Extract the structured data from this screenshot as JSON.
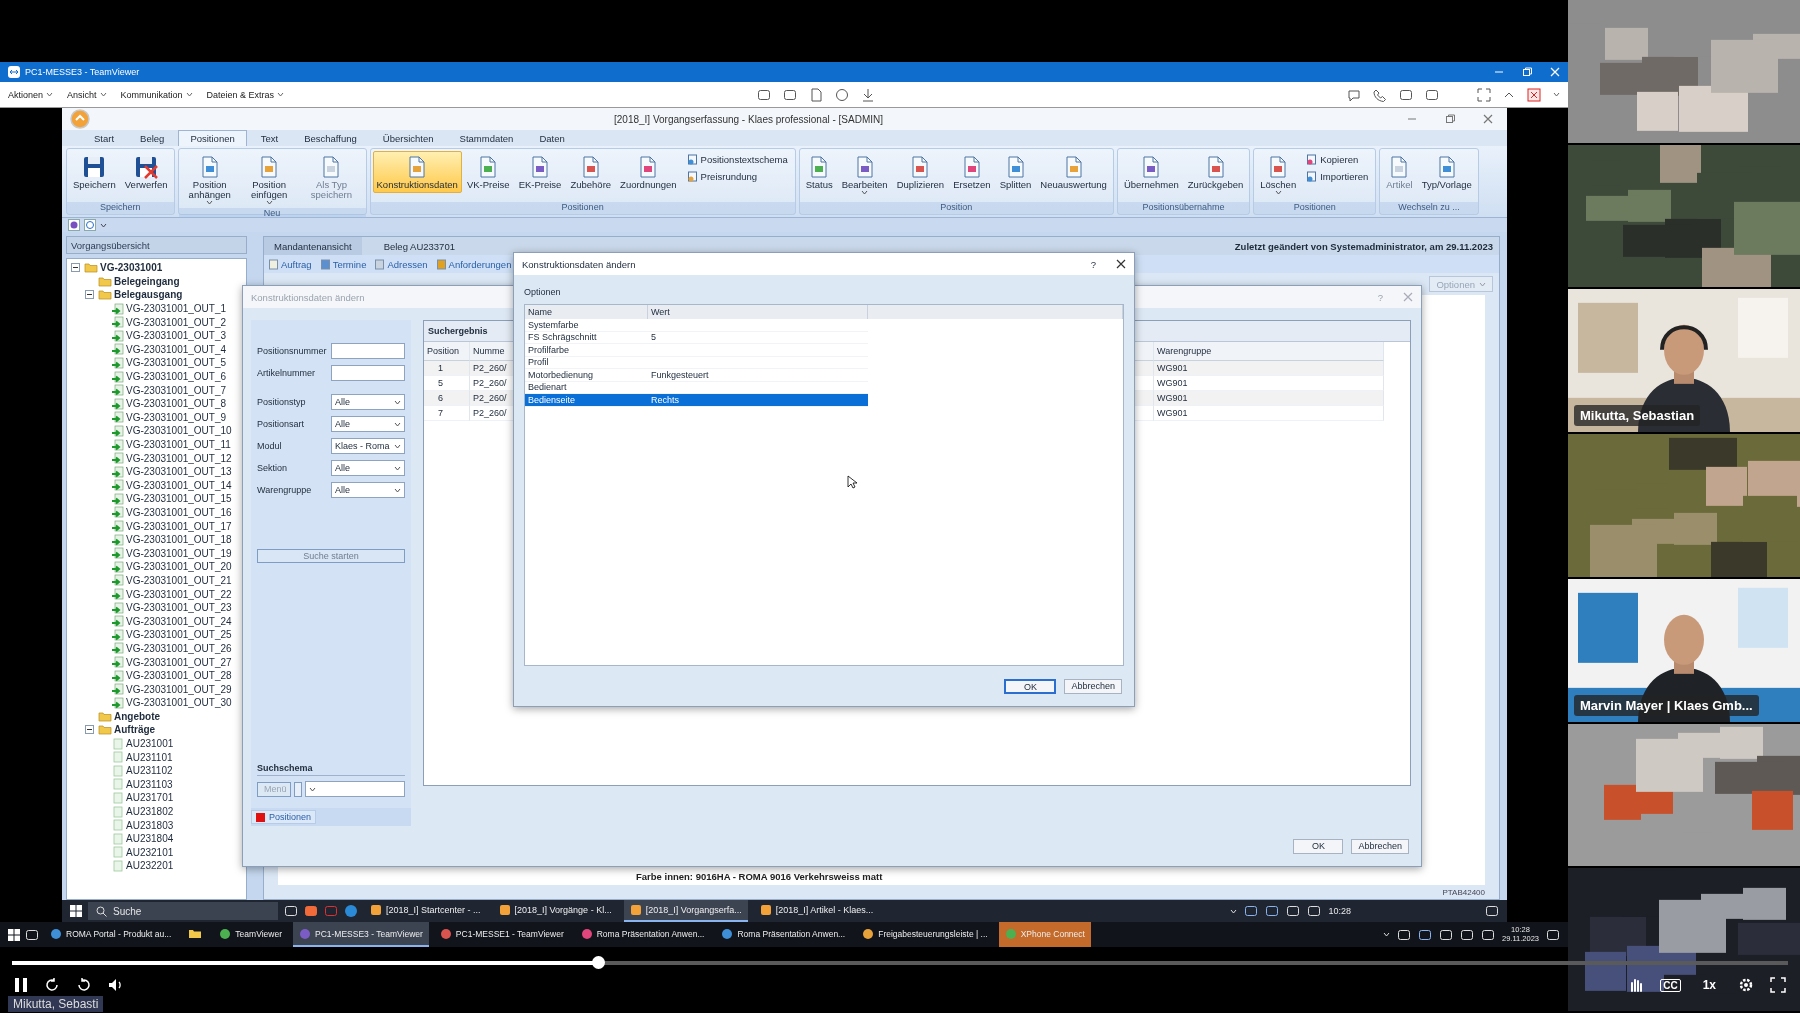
{
  "teamviewer": {
    "title": "PC1-MESSE3 - TeamViewer",
    "menu": [
      "Aktionen",
      "Ansicht",
      "Kommunikation",
      "Dateien & Extras"
    ]
  },
  "app": {
    "title": "[2018_I] Vorgangserfassung - Klaes professional - [SADMIN]",
    "ribbon_tabs": [
      {
        "label": "Start",
        "selected": false
      },
      {
        "label": "Beleg",
        "selected": false
      },
      {
        "label": "Positionen",
        "selected": true
      },
      {
        "label": "Text",
        "selected": false
      },
      {
        "label": "Beschaffung",
        "selected": false
      },
      {
        "label": "Übersichten",
        "selected": false
      },
      {
        "label": "Stammdaten",
        "selected": false
      },
      {
        "label": "Daten",
        "selected": false
      }
    ],
    "ribbon_groups": [
      {
        "label": "Speichern",
        "buttons": [
          {
            "label": "Speichern",
            "kind": "large",
            "disabled": false,
            "selected": false,
            "dropdown": false
          },
          {
            "label": "Verwerfen",
            "kind": "large",
            "disabled": false,
            "selected": false,
            "dropdown": false
          }
        ]
      },
      {
        "label": "Neu",
        "buttons": [
          {
            "label": "Position anhängen",
            "kind": "large",
            "disabled": false,
            "selected": false,
            "dropdown": true
          },
          {
            "label": "Position einfügen",
            "kind": "large",
            "disabled": false,
            "selected": false,
            "dropdown": true
          },
          {
            "label": "Als Typ speichern",
            "kind": "large",
            "disabled": true,
            "selected": false,
            "dropdown": false
          }
        ]
      },
      {
        "label": "Positionen",
        "buttons": [
          {
            "label": "Konstruktionsdaten",
            "kind": "large",
            "disabled": false,
            "selected": true,
            "dropdown": false
          },
          {
            "label": "VK-Preise",
            "kind": "large",
            "disabled": false,
            "selected": false,
            "dropdown": false
          },
          {
            "label": "EK-Preise",
            "kind": "large",
            "disabled": false,
            "selected": false,
            "dropdown": false
          },
          {
            "label": "Zubehöre",
            "kind": "large",
            "disabled": false,
            "selected": false,
            "dropdown": false
          },
          {
            "label": "Zuordnungen",
            "kind": "large",
            "disabled": false,
            "selected": false,
            "dropdown": false
          },
          {
            "label": "Positionstextschema",
            "kind": "small",
            "disabled": false,
            "selected": false,
            "dropdown": false
          },
          {
            "label": "Preisrundung",
            "kind": "small",
            "disabled": false,
            "selected": false,
            "dropdown": false
          }
        ]
      },
      {
        "label": "Position",
        "buttons": [
          {
            "label": "Status",
            "kind": "large",
            "disabled": false,
            "selected": false,
            "dropdown": false
          },
          {
            "label": "Bearbeiten",
            "kind": "large",
            "disabled": false,
            "selected": false,
            "dropdown": true
          },
          {
            "label": "Duplizieren",
            "kind": "large",
            "disabled": false,
            "selected": false,
            "dropdown": false
          },
          {
            "label": "Ersetzen",
            "kind": "large",
            "disabled": false,
            "selected": false,
            "dropdown": false
          },
          {
            "label": "Splitten",
            "kind": "large",
            "disabled": false,
            "selected": false,
            "dropdown": false
          },
          {
            "label": "Neuauswertung",
            "kind": "large",
            "disabled": false,
            "selected": false,
            "dropdown": false
          }
        ]
      },
      {
        "label": "Positionsübernahme",
        "buttons": [
          {
            "label": "Übernehmen",
            "kind": "large",
            "disabled": false,
            "selected": false,
            "dropdown": false
          },
          {
            "label": "Zurückgeben",
            "kind": "large",
            "disabled": false,
            "selected": false,
            "dropdown": false
          }
        ]
      },
      {
        "label": "Positionen",
        "buttons": [
          {
            "label": "Löschen",
            "kind": "large",
            "disabled": false,
            "selected": false,
            "dropdown": true
          },
          {
            "label": "Kopieren",
            "kind": "small",
            "disabled": false,
            "selected": false,
            "dropdown": false
          },
          {
            "label": "Importieren",
            "kind": "small",
            "disabled": false,
            "selected": false,
            "dropdown": false
          }
        ]
      },
      {
        "label": "Wechseln zu ...",
        "buttons": [
          {
            "label": "Artikel",
            "kind": "large",
            "disabled": true,
            "selected": false,
            "dropdown": false
          },
          {
            "label": "Typ/Vorlage",
            "kind": "large",
            "disabled": false,
            "selected": false,
            "dropdown": false
          }
        ]
      }
    ]
  },
  "overview": {
    "title": "Vorgangsübersicht",
    "tree": [
      {
        "label": "VG-23031001",
        "kind": "folder",
        "expanded": true,
        "children": [
          {
            "label": "Belegeingang",
            "kind": "folder"
          },
          {
            "label": "Belegausgang",
            "kind": "folder",
            "expanded": true,
            "children": [
              {
                "label": "VG-23031001_OUT_1",
                "kind": "outgoing"
              },
              {
                "label": "VG-23031001_OUT_2",
                "kind": "outgoing"
              },
              {
                "label": "VG-23031001_OUT_3",
                "kind": "outgoing"
              },
              {
                "label": "VG-23031001_OUT_4",
                "kind": "outgoing"
              },
              {
                "label": "VG-23031001_OUT_5",
                "kind": "outgoing"
              },
              {
                "label": "VG-23031001_OUT_6",
                "kind": "outgoing"
              },
              {
                "label": "VG-23031001_OUT_7",
                "kind": "outgoing"
              },
              {
                "label": "VG-23031001_OUT_8",
                "kind": "outgoing"
              },
              {
                "label": "VG-23031001_OUT_9",
                "kind": "outgoing"
              },
              {
                "label": "VG-23031001_OUT_10",
                "kind": "outgoing"
              },
              {
                "label": "VG-23031001_OUT_11",
                "kind": "outgoing"
              },
              {
                "label": "VG-23031001_OUT_12",
                "kind": "outgoing"
              },
              {
                "label": "VG-23031001_OUT_13",
                "kind": "outgoing"
              },
              {
                "label": "VG-23031001_OUT_14",
                "kind": "outgoing"
              },
              {
                "label": "VG-23031001_OUT_15",
                "kind": "outgoing"
              },
              {
                "label": "VG-23031001_OUT_16",
                "kind": "outgoing"
              },
              {
                "label": "VG-23031001_OUT_17",
                "kind": "outgoing"
              },
              {
                "label": "VG-23031001_OUT_18",
                "kind": "outgoing"
              },
              {
                "label": "VG-23031001_OUT_19",
                "kind": "outgoing"
              },
              {
                "label": "VG-23031001_OUT_20",
                "kind": "outgoing"
              },
              {
                "label": "VG-23031001_OUT_21",
                "kind": "outgoing"
              },
              {
                "label": "VG-23031001_OUT_22",
                "kind": "outgoing"
              },
              {
                "label": "VG-23031001_OUT_23",
                "kind": "outgoing"
              },
              {
                "label": "VG-23031001_OUT_24",
                "kind": "outgoing"
              },
              {
                "label": "VG-23031001_OUT_25",
                "kind": "outgoing"
              },
              {
                "label": "VG-23031001_OUT_26",
                "kind": "outgoing"
              },
              {
                "label": "VG-23031001_OUT_27",
                "kind": "outgoing"
              },
              {
                "label": "VG-23031001_OUT_28",
                "kind": "outgoing"
              },
              {
                "label": "VG-23031001_OUT_29",
                "kind": "outgoing"
              },
              {
                "label": "VG-23031001_OUT_30",
                "kind": "outgoing"
              }
            ]
          },
          {
            "label": "Angebote",
            "kind": "folder"
          },
          {
            "label": "Aufträge",
            "kind": "folder",
            "expanded": true,
            "children": [
              {
                "label": "AU231001",
                "kind": "order"
              },
              {
                "label": "AU231101",
                "kind": "order"
              },
              {
                "label": "AU231102",
                "kind": "order"
              },
              {
                "label": "AU231103",
                "kind": "order"
              },
              {
                "label": "AU231701",
                "kind": "order"
              },
              {
                "label": "AU231802",
                "kind": "order"
              },
              {
                "label": "AU231803",
                "kind": "order"
              },
              {
                "label": "AU231804",
                "kind": "order"
              },
              {
                "label": "AU232101",
                "kind": "order"
              },
              {
                "label": "AU232201",
                "kind": "order"
              }
            ]
          }
        ]
      }
    ]
  },
  "document": {
    "tab": "Mandantenansicht",
    "beleg": "Beleg AU233701",
    "changed": "Zuletzt geändert von Systemadministrator, am 29.11.2023",
    "links": [
      "Auftrag",
      "Termine",
      "Adressen",
      "Anforderungen"
    ],
    "options_button": "Optionen",
    "description": "Farbe innen: 9016HA - ROMA 9016 Verkehrsweiss matt",
    "status": "PTAB42400"
  },
  "search_dialog": {
    "title": "Konstruktionsdaten ändern",
    "help": "?",
    "fields": [
      {
        "label": "Positionsnummer",
        "kind": "text"
      },
      {
        "label": "Artikelnummer",
        "kind": "text"
      },
      {
        "label": "Positionstyp",
        "kind": "select",
        "value": "Alle"
      },
      {
        "label": "Positionsart",
        "kind": "select",
        "value": "Alle"
      },
      {
        "label": "Modul",
        "kind": "select",
        "value": "Klaes - Roma"
      },
      {
        "label": "Sektion",
        "kind": "select",
        "value": "Alle"
      },
      {
        "label": "Warengruppe",
        "kind": "select",
        "value": "Alle"
      }
    ],
    "search_button": {
      "label": "Suche starten",
      "disabled": true
    },
    "schema": {
      "label": "Suchschema",
      "menu_button": "Menü"
    },
    "tab": {
      "label": "Positionen",
      "color": "#e01010"
    },
    "results": {
      "title": "Suchergebnis",
      "columns": [
        "Position",
        "Numme",
        "Warengruppe"
      ],
      "rows": [
        [
          "1",
          "P2_260/",
          "WG901"
        ],
        [
          "5",
          "P2_260/",
          "WG901"
        ],
        [
          "6",
          "P2_260/",
          "WG901"
        ],
        [
          "7",
          "P2_260/",
          "WG901"
        ]
      ]
    },
    "buttons": [
      "OK",
      "Abbrechen"
    ]
  },
  "options_dialog": {
    "title": "Konstruktionsdaten ändern",
    "help": "?",
    "section": "Optionen",
    "columns": [
      "Name",
      "Wert"
    ],
    "rows": [
      {
        "name": "Systemfarbe",
        "selected": false
      },
      {
        "name": "FS Schrägschnitt",
        "value": "5",
        "selected": false
      },
      {
        "name": "Profilfarbe",
        "selected": false
      },
      {
        "name": "Profil",
        "selected": false
      },
      {
        "name": "Motorbedienung",
        "value": "Funkgesteuert",
        "selected": false
      },
      {
        "name": "Bedienart",
        "selected": false
      },
      {
        "name": "Bedienseite",
        "value": "Rechts",
        "selected": true
      }
    ],
    "buttons": [
      {
        "label": "OK",
        "default": true
      },
      {
        "label": "Abbrechen",
        "default": false
      }
    ]
  },
  "remote_taskbar": {
    "search": "Suche",
    "items": [
      {
        "label": "[2018_I] Startcenter - ...",
        "selected": false
      },
      {
        "label": "[2018_I] Vorgänge - Kl...",
        "selected": false
      },
      {
        "label": "[2018_I] Vorgangserfa...",
        "selected": true
      },
      {
        "label": "[2018_I] Artikel - Klaes...",
        "selected": false
      }
    ],
    "time": "10:28"
  },
  "local_taskbar": {
    "items": [
      {
        "kind": "window",
        "label": "ROMA Portal - Produkt au...",
        "selected": false,
        "highlighted": false
      },
      {
        "kind": "pinned",
        "selected": false,
        "highlighted": false
      },
      {
        "kind": "window",
        "label": "TeamViewer",
        "selected": false,
        "highlighted": false
      },
      {
        "kind": "window",
        "label": "PC1-MESSE3 - TeamViewer",
        "selected": true,
        "highlighted": false
      },
      {
        "kind": "window",
        "label": "PC1-MESSE1 - TeamViewer",
        "selected": false,
        "highlighted": false
      },
      {
        "kind": "window",
        "label": "Roma Präsentation Anwen...",
        "selected": false,
        "highlighted": false
      },
      {
        "kind": "window",
        "label": "Roma Präsentation Anwen...",
        "selected": false,
        "highlighted": false
      },
      {
        "kind": "window",
        "label": "Freigabesteuerungsleiste | ...",
        "selected": false,
        "highlighted": false
      },
      {
        "kind": "window",
        "label": "XPhone Connect",
        "selected": false,
        "highlighted": true
      }
    ],
    "time": "10:28",
    "date": "29.11.2023"
  },
  "player": {
    "level": 0.33,
    "captions": "CC",
    "speed": "1x",
    "speaker": "Mikutta, Sebasti"
  },
  "video_tiles": [
    {
      "kind": "picture"
    },
    {
      "kind": "picture"
    },
    {
      "kind": "person",
      "name": "Mikutta, Sebastian"
    },
    {
      "kind": "picture"
    },
    {
      "kind": "person",
      "name": "Marvin Mayer | Klaes Gmb..."
    },
    {
      "kind": "picture"
    },
    {
      "kind": "picture"
    }
  ]
}
